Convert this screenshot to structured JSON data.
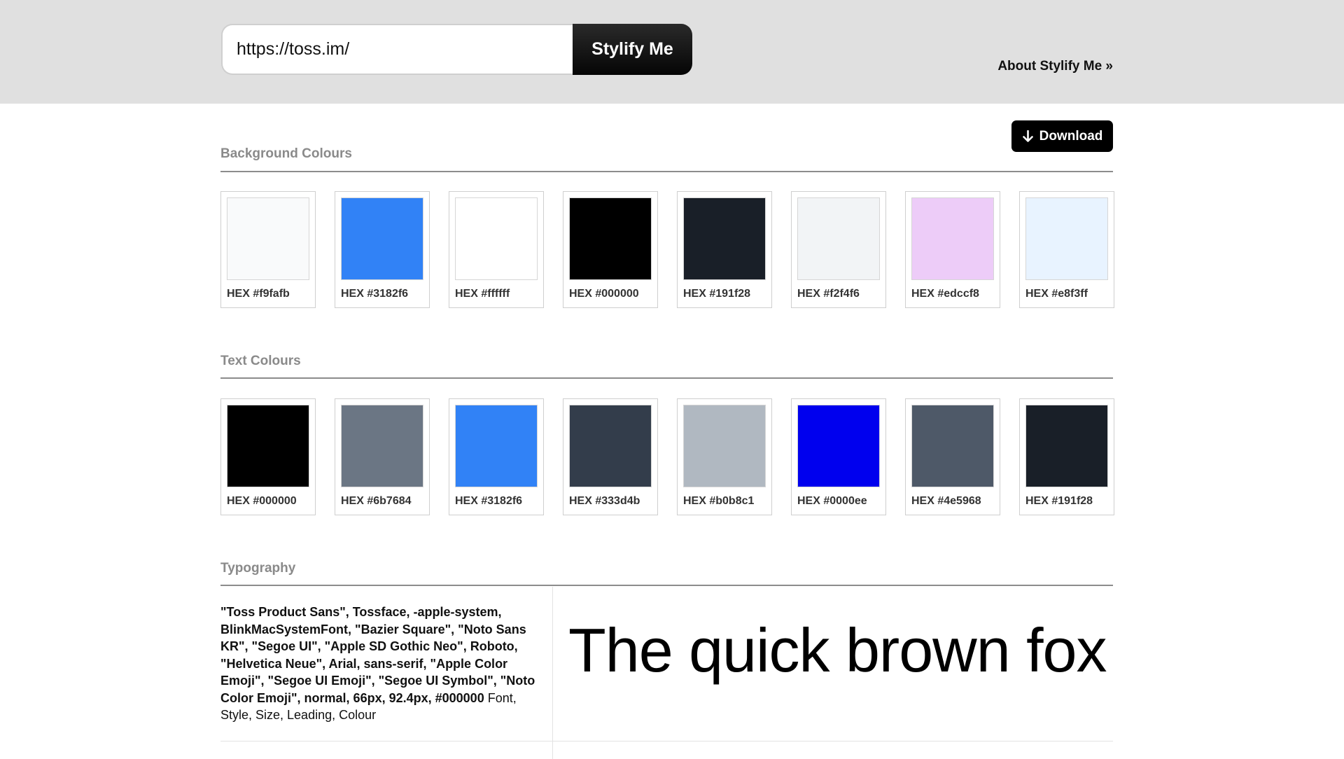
{
  "header": {
    "url_value": "https://toss.im/",
    "submit_label": "Stylify Me",
    "about_label": "About Stylify Me »"
  },
  "download": {
    "label": "Download",
    "icon": "arrow-down-icon"
  },
  "background_colours": {
    "title": "Background Colours",
    "swatches": [
      {
        "label": "HEX #f9fafb",
        "hex": "#f9fafb"
      },
      {
        "label": "HEX #3182f6",
        "hex": "#3182f6"
      },
      {
        "label": "HEX #ffffff",
        "hex": "#ffffff"
      },
      {
        "label": "HEX #000000",
        "hex": "#000000"
      },
      {
        "label": "HEX #191f28",
        "hex": "#191f28"
      },
      {
        "label": "HEX #f2f4f6",
        "hex": "#f2f4f6"
      },
      {
        "label": "HEX #edccf8",
        "hex": "#edccf8"
      },
      {
        "label": "HEX #e8f3ff",
        "hex": "#e8f3ff"
      }
    ]
  },
  "text_colours": {
    "title": "Text Colours",
    "swatches": [
      {
        "label": "HEX #000000",
        "hex": "#000000"
      },
      {
        "label": "HEX #6b7684",
        "hex": "#6b7684"
      },
      {
        "label": "HEX #3182f6",
        "hex": "#3182f6"
      },
      {
        "label": "HEX #333d4b",
        "hex": "#333d4b"
      },
      {
        "label": "HEX #b0b8c1",
        "hex": "#b0b8c1"
      },
      {
        "label": "HEX #0000ee",
        "hex": "#0000ee"
      },
      {
        "label": "HEX #4e5968",
        "hex": "#4e5968"
      },
      {
        "label": "HEX #191f28",
        "hex": "#191f28"
      }
    ]
  },
  "typography": {
    "title": "Typography",
    "entries": [
      {
        "font_spec": "\"Toss Product Sans\", Tossface, -apple-system, BlinkMacSystemFont, \"Bazier Square\", \"Noto Sans KR\", \"Segoe UI\", \"Apple SD Gothic Neo\", Roboto, \"Helvetica Neue\", Arial, sans-serif, \"Apple Color Emoji\", \"Segoe UI Emoji\", \"Segoe UI Symbol\", \"Noto Color Emoji\", normal, 66px, 92.4px, #000000",
        "legend": " Font, Style, Size, Leading, Colour",
        "sample_text": "The quick brown fox ."
      }
    ]
  }
}
